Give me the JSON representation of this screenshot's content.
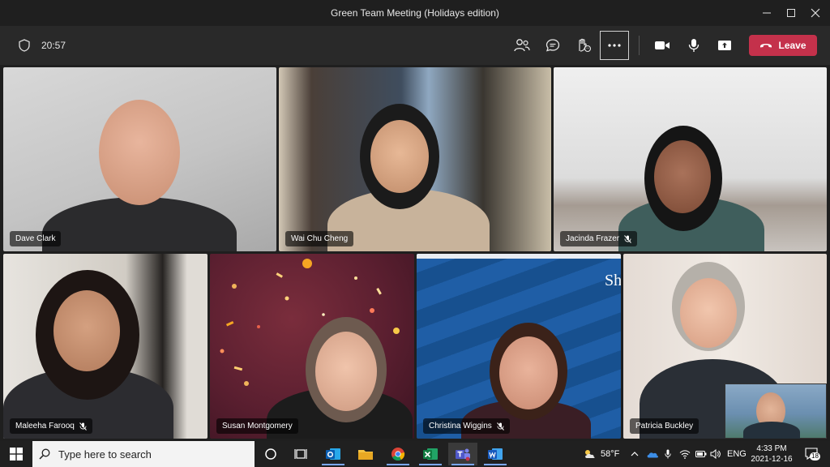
{
  "window": {
    "title": "Green Team Meeting (Holidays edition)"
  },
  "toolbar": {
    "timer": "20:57",
    "leave_label": "Leave"
  },
  "participants": [
    {
      "name": "Dave Clark",
      "muted": false
    },
    {
      "name": "Wai Chu Cheng",
      "muted": false
    },
    {
      "name": "Jacinda Frazer",
      "muted": true
    },
    {
      "name": "Maleeha Farooq",
      "muted": true
    },
    {
      "name": "Susan Montgomery",
      "muted": false
    },
    {
      "name": "Christina Wiggins",
      "muted": true
    },
    {
      "name": "Patricia Buckley",
      "muted": false
    }
  ],
  "background_text": "Sh",
  "taskbar": {
    "search_placeholder": "Type here to search",
    "weather": "58°F",
    "language": "ENG",
    "time": "4:33 PM",
    "date": "2021-12-16",
    "notification_count": "18"
  },
  "colors": {
    "leave": "#c4314b",
    "titlebar": "#1f1f1f",
    "toolbar": "#292929"
  }
}
